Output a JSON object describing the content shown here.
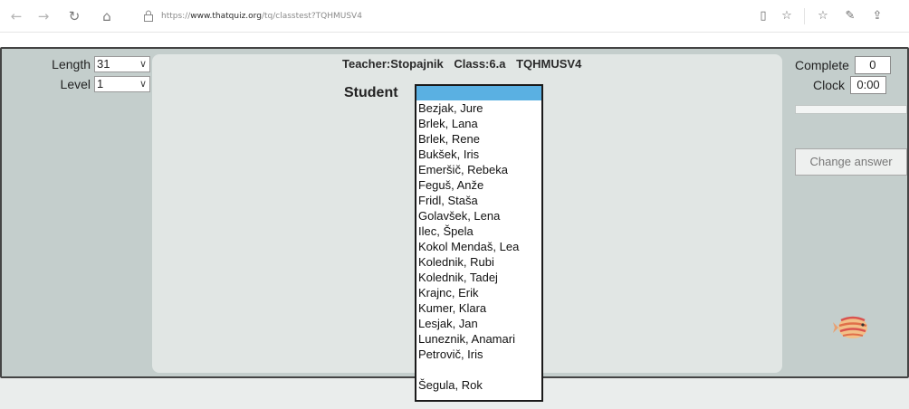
{
  "browser": {
    "url_prefix": "https://",
    "url_host": "www.thatquiz.org",
    "url_path": "/tq/classtest?TQHMUSV4",
    "icons": {
      "back": "←",
      "forward": "→",
      "refresh": "↻",
      "home": "⌂",
      "lock": "🔒",
      "reading_view": "▯",
      "favorite": "☆",
      "favorites_hub": "☆",
      "notes": "✎",
      "share": "⇪"
    }
  },
  "settings": {
    "length_label": "Length",
    "length_value": "31",
    "level_label": "Level",
    "level_value": "1",
    "chevron": "∨"
  },
  "header": {
    "teacher": "Teacher:Stopajnik",
    "class": "Class:6.a",
    "code": "TQHMUSV4"
  },
  "student": {
    "label": "Student",
    "options": [
      "",
      "Bezjak, Jure",
      "Brlek, Lana",
      "Brlek, Rene",
      "Bukšek, Iris",
      "Emeršič, Rebeka",
      "Feguš, Anže",
      "Fridl, Staša",
      "Golavšek, Lena",
      "Ilec, Špela",
      "Kokol Mendaš, Lea",
      "Kolednik, Rubi",
      "Kolednik, Tadej",
      "Krajnc, Erik",
      "Kumer, Klara",
      "Lesjak, Jan",
      "Luneznik, Anamari",
      "Petrovič, Iris",
      "",
      "Šegula, Rok"
    ]
  },
  "stats": {
    "complete_label": "Complete",
    "complete_value": "0",
    "clock_label": "Clock",
    "clock_value": "0:00",
    "progress_fraction": 0
  },
  "actions": {
    "change_answer": "Change answer"
  },
  "colors": {
    "page_bg": "#c4cecc",
    "panel_bg": "#e1e6e4",
    "selected_option": "#5ab0e2"
  }
}
